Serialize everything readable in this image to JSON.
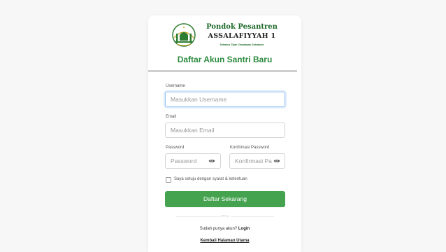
{
  "logo": {
    "line1": "Pondok Pesantren",
    "line2": "ASSALAFIYYAH 1",
    "tagline": "Sebakus Tipar Cimahayau Sukabumi"
  },
  "title": "Daftar Akun Santri Baru",
  "form": {
    "username": {
      "label": "Username",
      "placeholder": "Masukkan Username",
      "value": ""
    },
    "email": {
      "label": "Email",
      "placeholder": "Masukkan Email",
      "value": ""
    },
    "password": {
      "label": "Password",
      "placeholder": "Password",
      "value": ""
    },
    "confirm_password": {
      "label": "Konfirmasi Password",
      "placeholder": "Konfirmasi Password",
      "value": ""
    },
    "terms_label": "Saya setuju dengan syarat & ketentuan",
    "terms_checked": false,
    "submit_label": "Daftar Sekarang"
  },
  "separator_text": "ATAU",
  "footer": {
    "login_prompt": "Sudah punya akun?",
    "login_link": "Login",
    "home_link": "Kembali Halaman Utama"
  },
  "colors": {
    "accent": "#45a350",
    "title": "#2b8a3e",
    "background": "#f7f7f7"
  },
  "icons": {
    "password_toggle": "eye-icon",
    "confirm_toggle": "eye-icon"
  }
}
